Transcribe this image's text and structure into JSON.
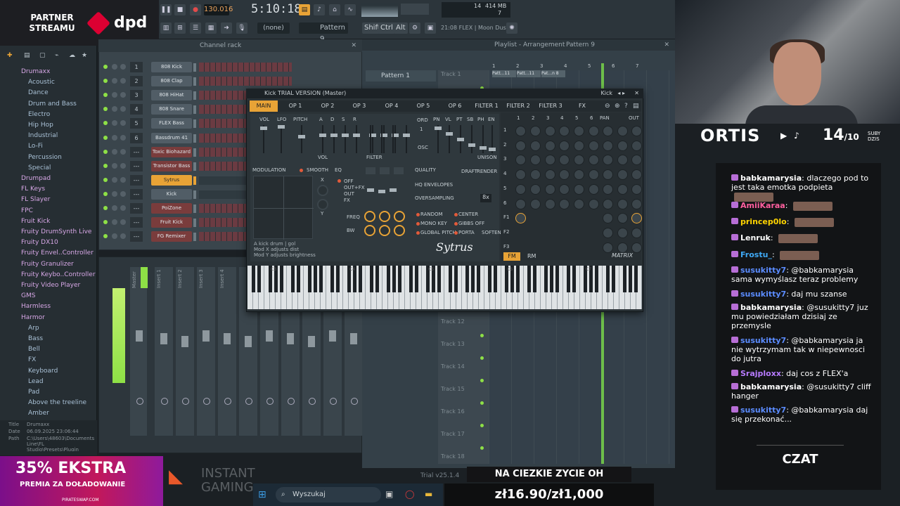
{
  "overlay": {
    "partner_label": "PARTNER STREAMU",
    "brand": "dpd"
  },
  "toolbar": {
    "tempo": "130.016",
    "timecode": "5:10:18",
    "preset_none": "(none)",
    "pattern": "Pattern 9",
    "shift": "Shift",
    "ctrl": "Ctrl",
    "alt": "Alt",
    "hint": "21:08 FLEX | Moon Dust",
    "memory": "414 MB",
    "mem_count": "14",
    "mem_voices": "7"
  },
  "browser": {
    "items": [
      {
        "label": "Drumaxx",
        "folder": true
      },
      {
        "label": "Acoustic"
      },
      {
        "label": "Dance"
      },
      {
        "label": "Drum and Bass"
      },
      {
        "label": "Electro"
      },
      {
        "label": "Hip Hop"
      },
      {
        "label": "Industrial"
      },
      {
        "label": "Lo-Fi"
      },
      {
        "label": "Percussion"
      },
      {
        "label": "Special"
      },
      {
        "label": "Drumpad",
        "folder": true
      },
      {
        "label": "FL Keys",
        "folder": true
      },
      {
        "label": "FL Slayer",
        "folder": true
      },
      {
        "label": "FPC",
        "folder": true
      },
      {
        "label": "Fruit Kick",
        "folder": true
      },
      {
        "label": "Fruity DrumSynth Live",
        "folder": true
      },
      {
        "label": "Fruity DX10",
        "folder": true
      },
      {
        "label": "Fruity Envel..Controller",
        "folder": true
      },
      {
        "label": "Fruity Granulizer",
        "folder": true
      },
      {
        "label": "Fruity Keybo..Controller",
        "folder": true
      },
      {
        "label": "Fruity Video Player",
        "folder": true
      },
      {
        "label": "GMS",
        "folder": true
      },
      {
        "label": "Harmless",
        "folder": true
      },
      {
        "label": "Harmor",
        "folder": true
      },
      {
        "label": "Arp"
      },
      {
        "label": "Bass"
      },
      {
        "label": "Bell"
      },
      {
        "label": "FX"
      },
      {
        "label": "Keyboard"
      },
      {
        "label": "Lead"
      },
      {
        "label": "Pad"
      },
      {
        "label": "Above the treeline"
      },
      {
        "label": "Amber"
      }
    ],
    "info_title_key": "Title",
    "info_title": "Drumaxx",
    "info_date_key": "Date",
    "info_date": "06.09.2025 23:06:44",
    "info_path_key": "Path",
    "info_path": "C:\\Users\\48603\\Documents\\Image-Line\\FL Studio\\Presets\\Plugin presets\\Generat..."
  },
  "channel_rack": {
    "title": "Channel rack",
    "channels": [
      {
        "num": "1",
        "name": "808 Kick",
        "style": "normal"
      },
      {
        "num": "2",
        "name": "808 Clap",
        "style": "normal"
      },
      {
        "num": "3",
        "name": "808 HiHat",
        "style": "normal"
      },
      {
        "num": "4",
        "name": "808 Snare",
        "style": "normal"
      },
      {
        "num": "5",
        "name": "FLEX Bass",
        "style": "normal"
      },
      {
        "num": "6",
        "name": "Bassdrum 41",
        "style": "normal"
      },
      {
        "num": "---",
        "name": "Toxic Biohazard",
        "style": "red"
      },
      {
        "num": "---",
        "name": "Transistor Bass",
        "style": "red"
      },
      {
        "num": "---",
        "name": "Sytrus",
        "style": "sel"
      },
      {
        "num": "---",
        "name": "Kick",
        "style": "normal"
      },
      {
        "num": "---",
        "name": "PoiZone",
        "style": "red"
      },
      {
        "num": "---",
        "name": "Fruit Kick",
        "style": "red"
      },
      {
        "num": "---",
        "name": "FG Remixer",
        "style": "red"
      }
    ]
  },
  "mixer": {
    "strips": [
      "Master",
      "Insert 1",
      "Insert 2",
      "Insert 3",
      "Insert 4"
    ]
  },
  "playlist": {
    "title": "Playlist - Arrangement",
    "pattern_crumb": "Pattern 9",
    "pattern_item": "Pattern 1",
    "tracks": [
      "Track 1",
      "Track 12",
      "Track 13",
      "Track 14",
      "Track 15",
      "Track 16",
      "Track 17",
      "Track 18"
    ],
    "clips": [
      "Patt...11",
      "Patt...11",
      "Pat...n 8"
    ],
    "ruler": [
      "1",
      "2",
      "3",
      "4",
      "5",
      "6",
      "7"
    ]
  },
  "sytrus": {
    "title": "Kick TRIAL VERSION (Master)",
    "preset": "Kick",
    "tabs": [
      "MAIN",
      "OP 1",
      "OP 2",
      "OP 3",
      "OP 4",
      "OP 5",
      "OP 6",
      "FILTER 1",
      "FILTER 2",
      "FILTER 3",
      "FX"
    ],
    "labels": {
      "vol": "VOL",
      "lfo": "LFO",
      "pitch": "PITCH",
      "vol_env": "VOL",
      "filter_env": "FILTER",
      "ord": "ORD",
      "osc": "OSC",
      "pn": "PN",
      "vl": "VL",
      "pt": "PT",
      "sb": "SB",
      "ph": "PH",
      "en": "EN",
      "unison": "UNISON",
      "modulation": "MODULATION",
      "smooth": "SMOOTH",
      "eq": "EQ",
      "off": "OFF",
      "out_fx": "OUT+FX",
      "out": "OUT",
      "fx": "FX",
      "freq": "FREQ",
      "bw": "BW",
      "quality": "QUALITY",
      "draft": "DRAFT",
      "render": "RENDER",
      "hq_env": "HQ ENVELOPES",
      "oversampling": "OVERSAMPLING",
      "oversampling_val": "8x",
      "random": "RANDOM",
      "center": "CENTER",
      "mono_key": "MONO KEY",
      "gibbs_off": "GIBBS OFF",
      "global_pitch": "GLOBAL PITCH",
      "porta": "PORTA",
      "soften": "SOFTEN",
      "desc1": "A kick drum  | gol",
      "desc2": "Mod X adjusts dist",
      "desc3": "Mod Y adjusts brightness",
      "logo": "Sytrus",
      "pan": "PAN",
      "out_col": "OUT",
      "fm": "FM",
      "rm": "RM",
      "matrix": "MATRIX",
      "x": "X",
      "y": "Y",
      "ord_val": "1",
      "adsr_a": "A",
      "adsr_d": "D",
      "adsr_s": "S",
      "adsr_r": "R"
    },
    "matrix_cols": [
      "1",
      "2",
      "3",
      "4",
      "5",
      "6"
    ],
    "matrix_rows": [
      "1",
      "2",
      "3",
      "4",
      "5",
      "6",
      "F1",
      "F2",
      "F3"
    ],
    "octaves": [
      "C3",
      "C4",
      "C5",
      "C6",
      "C7"
    ]
  },
  "stream": {
    "channel_name": "ORTIS",
    "sub_count": "14",
    "sub_goal": "/10",
    "sub_label_1": "SUBY",
    "sub_label_2": "DZIS"
  },
  "chat": {
    "title": "CZAT",
    "messages": [
      {
        "user": "babkamarysia",
        "color": "#ffffff",
        "text": "dlaczego pod to jest taka emotka podpieta",
        "emote": true
      },
      {
        "user": "AmiiKaraa",
        "color": "#ff5f9e",
        "text": "",
        "emote": true
      },
      {
        "user": "princep0lo",
        "color": "#ffd400",
        "text": "",
        "emote": true
      },
      {
        "user": "Lenruk",
        "color": "#ffffff",
        "text": "",
        "emote": true
      },
      {
        "user": "Frostu_",
        "color": "#3fa9f5",
        "text": "",
        "emote": true
      },
      {
        "user": "susukitty7",
        "color": "#5b8cff",
        "text": "@babkamarysia sama wymyślasz teraz problemy",
        "emote": false
      },
      {
        "user": "susukitty7",
        "color": "#5b8cff",
        "text": "daj mu szanse",
        "emote": false
      },
      {
        "user": "babkamarysia",
        "color": "#ffffff",
        "text": "@susukitty7 juz mu powiedziałam dzisiaj ze przemysle",
        "emote": false
      },
      {
        "user": "susukitty7",
        "color": "#5b8cff",
        "text": "@babkamarysia ja nie wytrzymam tak w niepewnosci do jutra",
        "emote": false
      },
      {
        "user": "Srajploxx",
        "color": "#b77bff",
        "text": "daj cos z FLEX'a",
        "emote": false
      },
      {
        "user": "babkamarysia",
        "color": "#ffffff",
        "text": "@susukitty7 cliff hanger",
        "emote": false
      },
      {
        "user": "susukitty7",
        "color": "#5b8cff",
        "text": "@babkamarysia daj się przekonać...",
        "emote": false
      }
    ]
  },
  "bottom": {
    "promo_big": "35% EKSTRA",
    "promo_sub": "PREMIA ZA DOŁADOWANIE",
    "promo_small": "PIRATESWAP.COM",
    "instant_gaming": "INSTANT GAMING",
    "search_placeholder": "Wyszukaj",
    "trial": "Trial v25.1.4",
    "ticker": "NA CIEZKIE ZYCIE OH",
    "price": "zł16.90/zł1,000"
  },
  "colors": {
    "accent": "#e8a336",
    "green": "#7cdd4a",
    "panel": "#2a3236"
  }
}
